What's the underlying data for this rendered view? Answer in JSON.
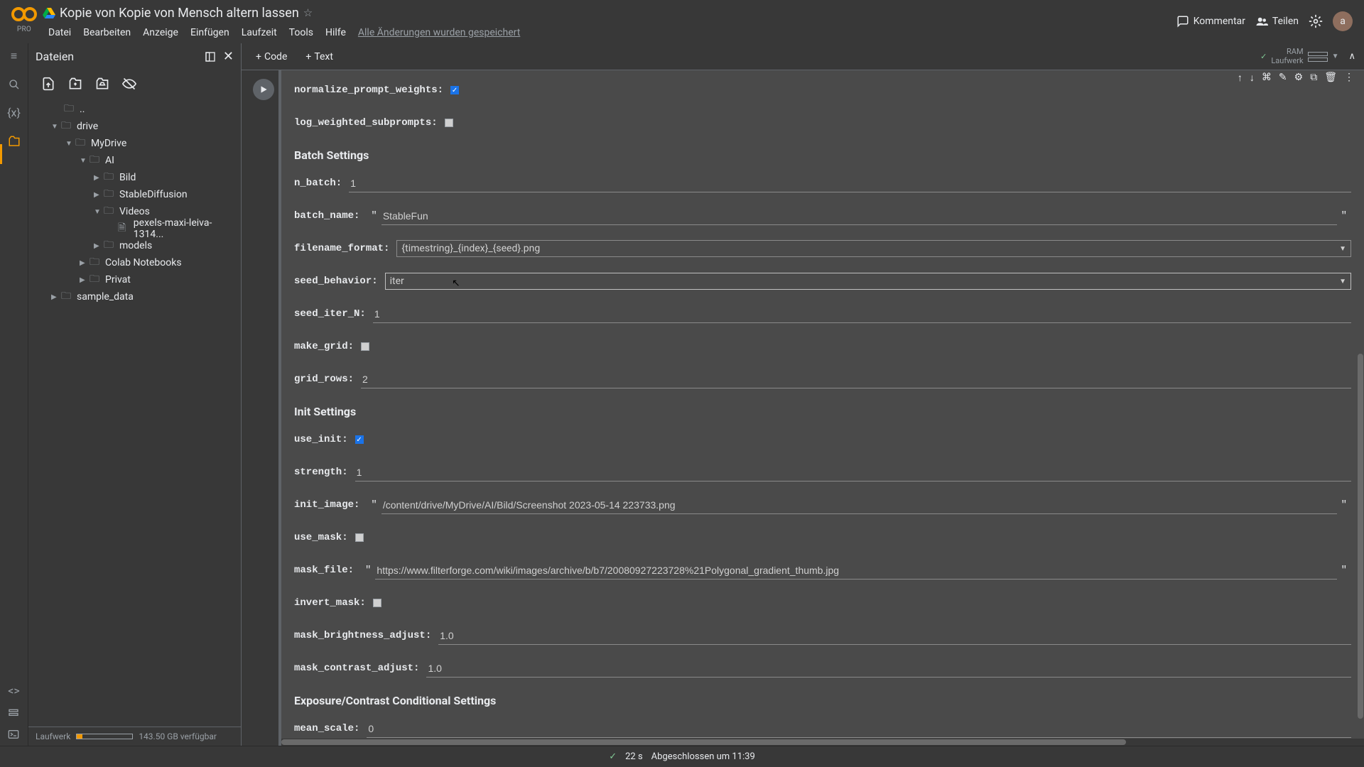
{
  "header": {
    "pro": "PRO",
    "title": "Kopie von Kopie von Mensch altern lassen",
    "menus": [
      "Datei",
      "Bearbeiten",
      "Anzeige",
      "Einfügen",
      "Laufzeit",
      "Tools",
      "Hilfe"
    ],
    "save_status": "Alle Änderungen wurden gespeichert",
    "kommentar": "Kommentar",
    "teilen": "Teilen",
    "avatar": "a"
  },
  "toolbar": {
    "code": "Code",
    "text": "Text",
    "ram": "RAM",
    "laufwerk": "Laufwerk"
  },
  "sidebar": {
    "title": "Dateien",
    "footer_label": "Laufwerk",
    "footer_free": "143.50 GB verfügbar"
  },
  "tree": {
    "dotdot": "..",
    "drive": "drive",
    "mydrive": "MyDrive",
    "ai": "AI",
    "bild": "Bild",
    "stablediffusion": "StableDiffusion",
    "videos": "Videos",
    "pexels": "pexels-maxi-leiva-1314...",
    "models": "models",
    "colab": "Colab Notebooks",
    "privat": "Privat",
    "sample": "sample_data"
  },
  "form": {
    "normalize_prompt_weights": {
      "label": "normalize_prompt_weights:",
      "checked": true
    },
    "log_weighted_subprompts": {
      "label": "log_weighted_subprompts:",
      "checked": false
    },
    "batch_heading": "Batch Settings",
    "n_batch": {
      "label": "n_batch:",
      "value": "1"
    },
    "batch_name": {
      "label": "batch_name:",
      "value": "StableFun"
    },
    "filename_format": {
      "label": "filename_format:",
      "value": "{timestring}_{index}_{seed}.png"
    },
    "seed_behavior": {
      "label": "seed_behavior:",
      "value": "iter"
    },
    "seed_iter_N": {
      "label": "seed_iter_N:",
      "value": "1"
    },
    "make_grid": {
      "label": "make_grid:",
      "checked": false
    },
    "grid_rows": {
      "label": "grid_rows:",
      "value": "2"
    },
    "init_heading": "Init Settings",
    "use_init": {
      "label": "use_init:",
      "checked": true
    },
    "strength": {
      "label": "strength:",
      "value": "1"
    },
    "init_image": {
      "label": "init_image:",
      "value": "/content/drive/MyDrive/AI/Bild/Screenshot 2023-05-14 223733.png"
    },
    "use_mask": {
      "label": "use_mask:",
      "checked": false
    },
    "mask_file": {
      "label": "mask_file:",
      "value": "https://www.filterforge.com/wiki/images/archive/b/b7/20080927223728%21Polygonal_gradient_thumb.jpg"
    },
    "invert_mask": {
      "label": "invert_mask:",
      "checked": false
    },
    "mask_brightness_adjust": {
      "label": "mask_brightness_adjust:",
      "value": "1.0"
    },
    "mask_contrast_adjust": {
      "label": "mask_contrast_adjust:",
      "value": "1.0"
    },
    "exposure_heading": "Exposure/Contrast Conditional Settings",
    "mean_scale": {
      "label": "mean_scale:",
      "value": "0"
    }
  },
  "status": {
    "duration": "22 s",
    "completed": "Abgeschlossen um 11:39"
  }
}
